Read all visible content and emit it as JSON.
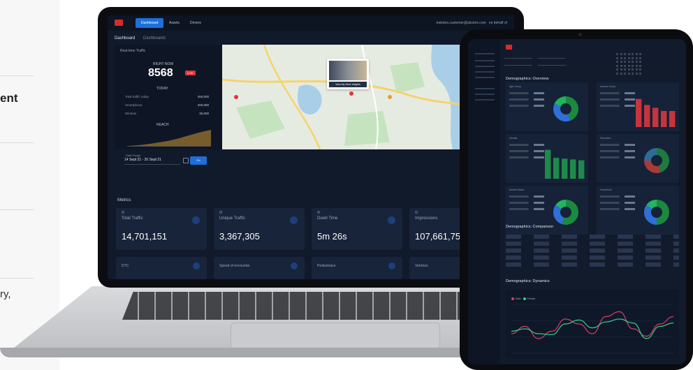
{
  "left_page": {
    "heading_fragment": "ent",
    "text_fragment": "ry,"
  },
  "laptop": {
    "nav": {
      "tabs": [
        "Dashboard",
        "Assets",
        "Drivers"
      ],
      "active_tab": "Dashboard",
      "user_email": "mekdes.customer@alcotrix.com",
      "right_label": "on behalf of"
    },
    "breadcrumb": {
      "title": "Dashboard",
      "current": "Dashboards"
    },
    "realtime": {
      "title": "Real-time Traffic",
      "right_now_label": "RIGHT NOW",
      "count": "8568",
      "live_badge": "LIVE",
      "today_label": "TODAY",
      "rows": [
        {
          "label": "Total traffic today",
          "value": "450,000"
        },
        {
          "label": "Smartphone",
          "value": "400,000"
        },
        {
          "label": "Window",
          "value": "36,000"
        }
      ],
      "reach_label": "REACH",
      "reach_series": [
        2,
        4,
        6,
        9,
        12,
        16,
        20,
        25,
        31,
        38,
        45,
        52,
        58,
        63
      ],
      "map_tooltip": "View My Store Insights"
    },
    "date_filter": {
      "label": "Date Range",
      "value": "14 Sept 21 - 20 Sept 21",
      "apply_label": "Go"
    },
    "metrics": {
      "title": "Metrics",
      "cards": [
        {
          "label": "Total Traffic",
          "value": "14,701,151"
        },
        {
          "label": "Unique Traffic",
          "value": "3,367,305"
        },
        {
          "label": "Dwell Time",
          "value": "5m 26s"
        },
        {
          "label": "Impressions",
          "value": "107,661,75"
        }
      ],
      "second_row": [
        {
          "label": "DTC"
        },
        {
          "label": "Speed of encounter"
        },
        {
          "label": "Pedestrians"
        },
        {
          "label": "Vehicles"
        }
      ]
    }
  },
  "tablet": {
    "sections": {
      "overview": "Demographics: Overview",
      "comparison": "Demographics: Comparison",
      "dynamics": "Demographics: Dynamics"
    },
    "overview_cards": [
      {
        "title": "Age Group",
        "chart": "donut",
        "slices": [
          44,
          38,
          18
        ],
        "colors": [
          "#1a8a3e",
          "#2f6fd6",
          "#20b35a"
        ]
      },
      {
        "title": "Income Group",
        "chart": "bar",
        "values": [
          70,
          55,
          48,
          40,
          40
        ],
        "bar_color": "#c7343c"
      },
      {
        "title": "Gender",
        "chart": "bar",
        "values": [
          72,
          52,
          50,
          48,
          46
        ],
        "bar_color": "#1e8a4a"
      },
      {
        "title": "Education",
        "chart": "donut",
        "slices": [
          45,
          30,
          25
        ],
        "colors": [
          "#1e7a3e",
          "#a83a3a",
          "#2a6d9a"
        ]
      },
      {
        "title": "Marital Status",
        "chart": "donut",
        "slices": [
          55,
          30,
          15
        ],
        "colors": [
          "#1a8a3e",
          "#2f6fd6",
          "#23b55f"
        ]
      },
      {
        "title": "Household",
        "chart": "donut",
        "slices": [
          50,
          35,
          15
        ],
        "colors": [
          "#1a8a3e",
          "#2f6fd6",
          "#23b55f"
        ]
      }
    ],
    "dynamics_chart": {
      "legend": [
        "Male",
        "Female"
      ],
      "colors": [
        "#e03a6a",
        "#2fcf8a"
      ],
      "series_a": [
        40,
        55,
        30,
        45,
        70,
        60,
        40,
        75,
        85,
        50,
        35,
        60,
        75
      ],
      "series_b": [
        45,
        50,
        40,
        38,
        60,
        68,
        52,
        64,
        70,
        62,
        30,
        55,
        62
      ]
    }
  }
}
